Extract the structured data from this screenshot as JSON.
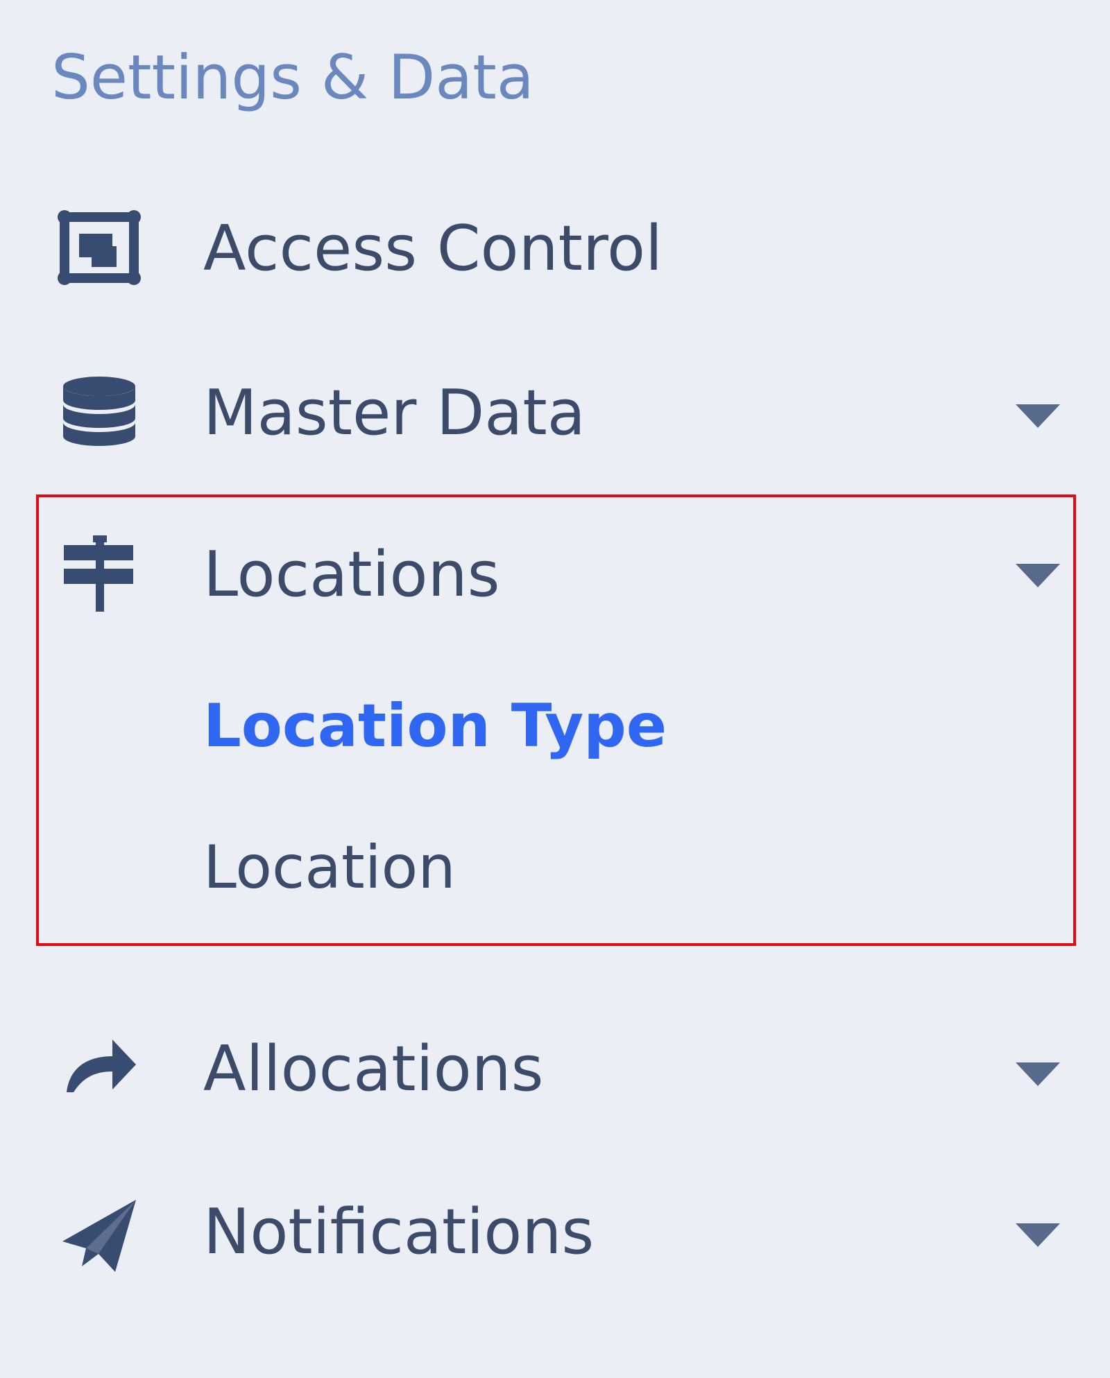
{
  "sidebar": {
    "title": "Settings & Data",
    "items": [
      {
        "label": "Access Control",
        "icon": "access-control-icon",
        "has_dropdown": false
      },
      {
        "label": "Master Data",
        "icon": "database-icon",
        "has_dropdown": true
      },
      {
        "label": "Locations",
        "icon": "signpost-icon",
        "has_dropdown": true,
        "subitems": [
          {
            "label": "Location Type",
            "active": true
          },
          {
            "label": "Location",
            "active": false
          }
        ]
      },
      {
        "label": "Allocations",
        "icon": "share-arrow-icon",
        "has_dropdown": true
      },
      {
        "label": "Notifications",
        "icon": "paper-plane-icon",
        "has_dropdown": true
      }
    ]
  },
  "colors": {
    "background": "#ebeef5",
    "title": "#6a88bd",
    "text": "#3b4b69",
    "icon": "#384b71",
    "active": "#2f67f2",
    "highlight": "#e50914"
  }
}
